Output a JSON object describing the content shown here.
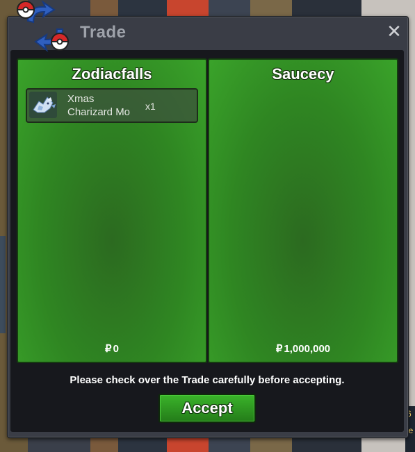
{
  "window": {
    "title": "Trade",
    "close_icon": "close-icon"
  },
  "colors": {
    "panel_green": "#2f8622",
    "accept_green": "#2f9a22",
    "window_bg": "#3a3d46"
  },
  "left_panel": {
    "name": "Zodiacfalls",
    "items": [
      {
        "name_line1": "Xmas",
        "name_line2": "Charizard Mo",
        "qty": "x1",
        "icon": "charizard-icon"
      }
    ],
    "money_symbol": "₽",
    "money": "0"
  },
  "right_panel": {
    "name": "Saucecy",
    "items": [],
    "money_symbol": "₽",
    "money": "1,000,000"
  },
  "notice": "Please check over the Trade carefully before accepting.",
  "accept_label": "Accept",
  "background_text": {
    "right_1": "6",
    "right_2": "le"
  }
}
